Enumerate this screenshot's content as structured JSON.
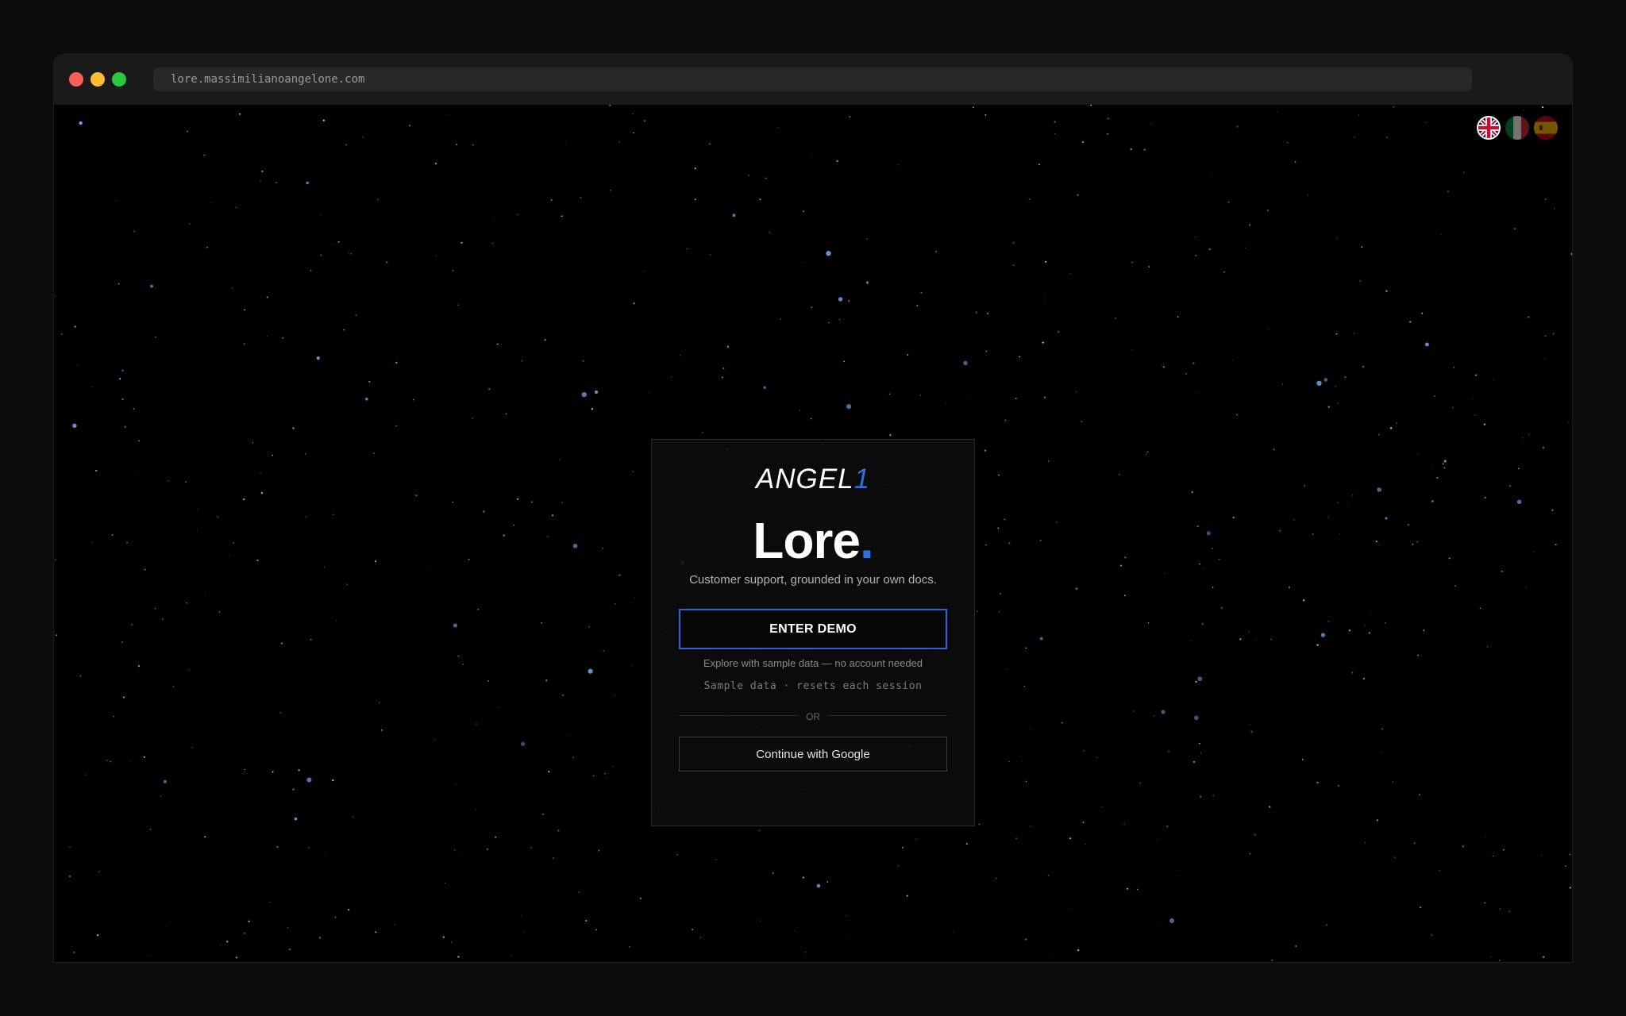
{
  "browser": {
    "url": "lore.massimilianoangelone.com"
  },
  "languages": [
    {
      "code": "en",
      "icon": "uk-flag-icon",
      "active": true
    },
    {
      "code": "it",
      "icon": "italy-flag-icon",
      "active": false
    },
    {
      "code": "es",
      "icon": "spain-flag-icon",
      "active": false
    }
  ],
  "card": {
    "brand_text": "ANGEL",
    "brand_accent": "1",
    "product_name": "Lore",
    "product_period": ".",
    "tagline": "Customer support, grounded in your own docs.",
    "demo_button": "ENTER DEMO",
    "demo_subtext": "Explore with sample data — no account needed",
    "demo_note": "Sample data · resets each session",
    "divider": "OR",
    "google_button": "Continue with Google"
  },
  "colors": {
    "accent": "#2f6fe0",
    "background": "#000000",
    "card_border": "#2a2a2a"
  }
}
